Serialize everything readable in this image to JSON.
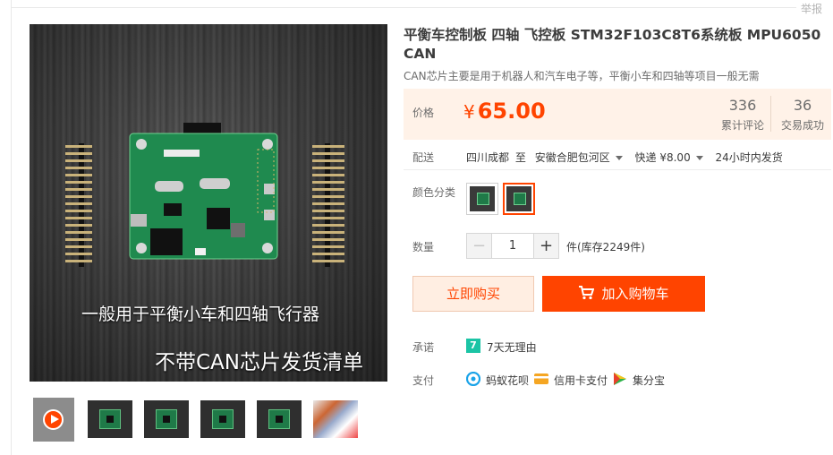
{
  "header": {
    "report_label": "举报"
  },
  "gallery": {
    "caption_line1": "一般用于平衡小车和四轴飞行器",
    "caption_line2": "不带CAN芯片发货清单",
    "thumbnail_count": 6
  },
  "product": {
    "title": "平衡车控制板 四轴 飞控板 STM32F103C8T6系统板 MPU6050 CAN",
    "subtitle": "CAN芯片主要是用于机器人和汽车电子等，平衡小车和四轴等项目一般无需"
  },
  "price": {
    "label": "价格",
    "currency": "¥",
    "amount": "65.00",
    "reviews_count": "336",
    "reviews_label": "累计评论",
    "sales_count": "36",
    "sales_label": "交易成功"
  },
  "shipping": {
    "label": "配送",
    "from": "四川成都",
    "to_word": "至",
    "destination": "安徽合肥包河区",
    "method": "快递 ¥8.00",
    "dispatch": "24小时内发货"
  },
  "color": {
    "label": "颜色分类",
    "selected_index": 1
  },
  "quantity": {
    "label": "数量",
    "value": "1",
    "minus": "−",
    "plus": "+",
    "stock_text": "件(库存2249件)"
  },
  "actions": {
    "buy_now": "立即购买",
    "add_to_cart": "加入购物车"
  },
  "promise": {
    "label": "承诺",
    "badge": "7",
    "text": "7天无理由"
  },
  "payment": {
    "label": "支付",
    "methods": [
      "蚂蚁花呗",
      "信用卡支付",
      "集分宝"
    ]
  },
  "colors": {
    "accent": "#ff4400",
    "price_bg": "#fff2e8",
    "buy_now_bg": "#ffeee2",
    "promise_green": "#1bc4a5"
  }
}
